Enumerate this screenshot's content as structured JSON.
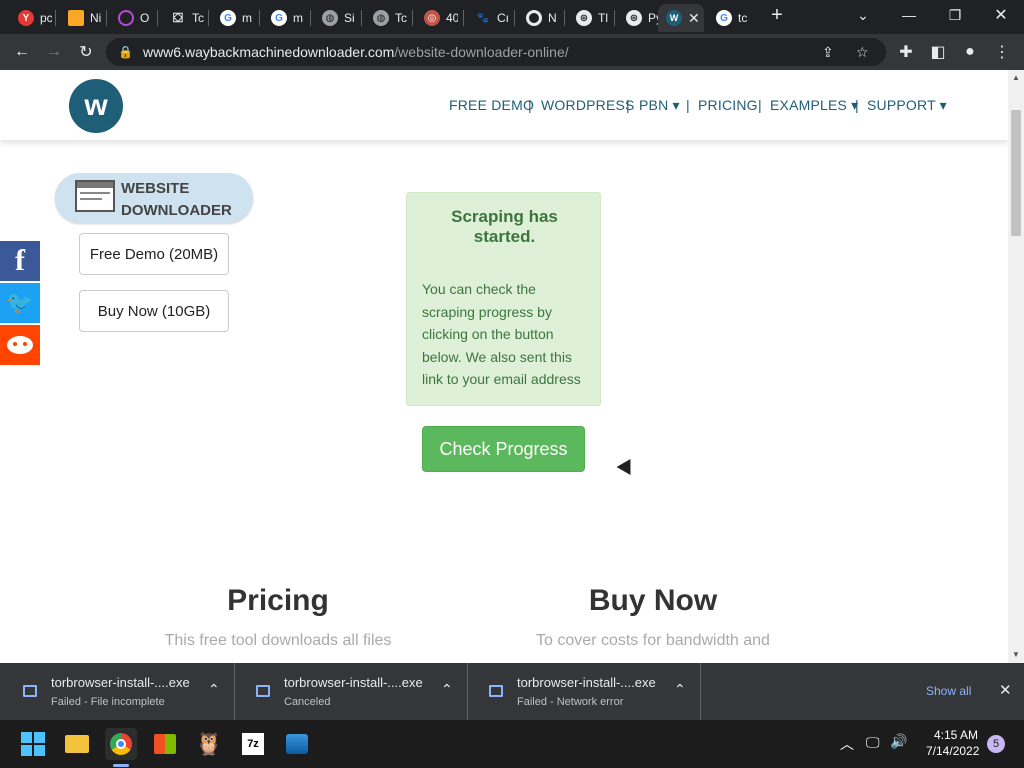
{
  "tabs": [
    {
      "favicon": "Y",
      "title": "pc"
    },
    {
      "favicon": "folder-icon",
      "title": "Ni"
    },
    {
      "favicon": "O",
      "title": "O"
    },
    {
      "favicon": "shell-icon",
      "title": "Tc"
    },
    {
      "favicon": "G",
      "title": "m"
    },
    {
      "favicon": "G",
      "title": "m"
    },
    {
      "favicon": "globe-icon",
      "title": "Si"
    },
    {
      "favicon": "globe-icon",
      "title": "Tc"
    },
    {
      "favicon": "circle-icon",
      "title": "40"
    },
    {
      "favicon": "cat-icon",
      "title": "Cı"
    },
    {
      "favicon": "chrome-icon",
      "title": "N"
    },
    {
      "favicon": "openai-icon",
      "title": "Tl"
    },
    {
      "favicon": "openai-icon",
      "title": "Py"
    },
    {
      "favicon": "W",
      "title": ""
    },
    {
      "favicon": "G",
      "title": "tc"
    }
  ],
  "address": {
    "host": "www6.waybackmachinedownloader.com",
    "path": "/website-downloader-online/"
  },
  "site": {
    "logo_letter": "w",
    "nav": [
      {
        "label": "FREE DEMO"
      },
      {
        "label": "WORDPRESS"
      },
      {
        "label": "PBN ▾"
      },
      {
        "label": "PRICING"
      },
      {
        "label": "EXAMPLES ▾"
      },
      {
        "label": "SUPPORT ▾"
      }
    ],
    "badge_line1": "WEBSITE",
    "badge_line2": "DOWNLOADER",
    "free_demo_button": "Free Demo (20MB)",
    "buy_now_button": "Buy Now (10GB)",
    "social": [
      "f",
      "twitter-bird",
      "reddit-alien"
    ],
    "status_title": "Scraping has started.",
    "status_body": "You can check the scraping progress by clicking on the button below. We also sent this link to your email address",
    "check_button": "Check Progress",
    "pricing_heading": "Pricing",
    "pricing_text": "This free tool downloads all files",
    "buy_heading": "Buy Now",
    "buy_text": "To cover costs for bandwidth and"
  },
  "downloads": [
    {
      "name": "torbrowser-install-....exe",
      "status": "Failed - File incomplete"
    },
    {
      "name": "torbrowser-install-....exe",
      "status": "Canceled"
    },
    {
      "name": "torbrowser-install-....exe",
      "status": "Failed - Network error"
    }
  ],
  "show_all": "Show all",
  "taskbar": {
    "time": "4:15 AM",
    "date": "7/14/2022",
    "notif_count": "5"
  },
  "colors": {
    "brand": "#1f5e77",
    "success_bg": "#dff0d8",
    "success_text": "#3c763d",
    "button_green": "#5cb85c"
  }
}
